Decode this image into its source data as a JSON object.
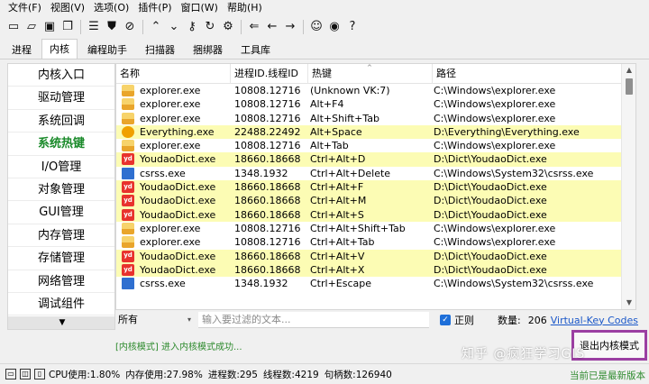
{
  "menubar": {
    "items": [
      "文件(F)",
      "视图(V)",
      "选项(O)",
      "插件(P)",
      "窗口(W)",
      "帮助(H)"
    ]
  },
  "toolbar": {
    "icons": [
      "monitor-icon",
      "open-folder-icon",
      "save-icon",
      "copy-icon",
      "windows-list-icon",
      "shield-icon",
      "ban-icon",
      "chevron-up-icon",
      "chevron-down-icon",
      "key-icon",
      "wrench-icon",
      "refresh-icon",
      "settings-icon",
      "back-icon",
      "forward-icon",
      "arrow-left-icon",
      "arrow-right-icon",
      "user-icon",
      "github-icon",
      "help-icon"
    ]
  },
  "tabs": [
    "进程",
    "内核",
    "编程助手",
    "扫描器",
    "捆绑器",
    "工具库"
  ],
  "active_tab": "内核",
  "leftnav": {
    "items": [
      "内核入口",
      "驱动管理",
      "系统回调",
      "系统热键",
      "I/O管理",
      "对象管理",
      "GUI管理",
      "内存管理",
      "存储管理",
      "网络管理",
      "调试组件"
    ],
    "active": "系统热键",
    "scroll_down": "▼"
  },
  "table": {
    "headers": [
      "名称",
      "进程ID.线程ID",
      "热键",
      "路径"
    ],
    "sort_indicator": "^",
    "rows": [
      {
        "icon": "folder",
        "name": "explorer.exe",
        "pid": "10808.12716",
        "hotkey": "(Unknown VK:7)",
        "path": "C:\\Windows\\explorer.exe",
        "hl": false
      },
      {
        "icon": "folder",
        "name": "explorer.exe",
        "pid": "10808.12716",
        "hotkey": "Alt+F4",
        "path": "C:\\Windows\\explorer.exe",
        "hl": false
      },
      {
        "icon": "folder",
        "name": "explorer.exe",
        "pid": "10808.12716",
        "hotkey": "Alt+Shift+Tab",
        "path": "C:\\Windows\\explorer.exe",
        "hl": false
      },
      {
        "icon": "search",
        "name": "Everything.exe",
        "pid": "22488.22492",
        "hotkey": "Alt+Space",
        "path": "D:\\Everything\\Everything.exe",
        "hl": true
      },
      {
        "icon": "folder",
        "name": "explorer.exe",
        "pid": "10808.12716",
        "hotkey": "Alt+Tab",
        "path": "C:\\Windows\\explorer.exe",
        "hl": false
      },
      {
        "icon": "yd",
        "name": "YoudaoDict.exe",
        "pid": "18660.18668",
        "hotkey": "Ctrl+Alt+D",
        "path": "D:\\Dict\\YoudaoDict.exe",
        "hl": true
      },
      {
        "icon": "sys",
        "name": "csrss.exe",
        "pid": "1348.1932",
        "hotkey": "Ctrl+Alt+Delete",
        "path": "C:\\Windows\\System32\\csrss.exe",
        "hl": false
      },
      {
        "icon": "yd",
        "name": "YoudaoDict.exe",
        "pid": "18660.18668",
        "hotkey": "Ctrl+Alt+F",
        "path": "D:\\Dict\\YoudaoDict.exe",
        "hl": true
      },
      {
        "icon": "yd",
        "name": "YoudaoDict.exe",
        "pid": "18660.18668",
        "hotkey": "Ctrl+Alt+M",
        "path": "D:\\Dict\\YoudaoDict.exe",
        "hl": true
      },
      {
        "icon": "yd",
        "name": "YoudaoDict.exe",
        "pid": "18660.18668",
        "hotkey": "Ctrl+Alt+S",
        "path": "D:\\Dict\\YoudaoDict.exe",
        "hl": true
      },
      {
        "icon": "folder",
        "name": "explorer.exe",
        "pid": "10808.12716",
        "hotkey": "Ctrl+Alt+Shift+Tab",
        "path": "C:\\Windows\\explorer.exe",
        "hl": false
      },
      {
        "icon": "folder",
        "name": "explorer.exe",
        "pid": "10808.12716",
        "hotkey": "Ctrl+Alt+Tab",
        "path": "C:\\Windows\\explorer.exe",
        "hl": false
      },
      {
        "icon": "yd",
        "name": "YoudaoDict.exe",
        "pid": "18660.18668",
        "hotkey": "Ctrl+Alt+V",
        "path": "D:\\Dict\\YoudaoDict.exe",
        "hl": true
      },
      {
        "icon": "yd",
        "name": "YoudaoDict.exe",
        "pid": "18660.18668",
        "hotkey": "Ctrl+Alt+X",
        "path": "D:\\Dict\\YoudaoDict.exe",
        "hl": true
      },
      {
        "icon": "sys",
        "name": "csrss.exe",
        "pid": "1348.1932",
        "hotkey": "Ctrl+Escape",
        "path": "C:\\Windows\\System32\\csrss.exe",
        "hl": false
      }
    ],
    "highlight_color": "#fcfcb4"
  },
  "filter": {
    "scope_value": "所有",
    "placeholder": "输入要过滤的文本...",
    "value": "",
    "regex_checked": true,
    "regex_label": "正则",
    "count_label": "数量:",
    "count_value": "206",
    "vk_link": "Virtual-Key Codes"
  },
  "log": {
    "text": "[内核模式] 进入内核模式成功..."
  },
  "exit_button": {
    "label": "退出内核模式",
    "highlight_color": "#9b3fa2"
  },
  "statusbar": {
    "cpu": "CPU使用:1.80%",
    "mem": "内存使用:27.98%",
    "procs": "进程数:295",
    "threads": "线程数:4219",
    "handles": "句柄数:126940",
    "update": "当前已是最新版本"
  },
  "watermark": "知乎 @疯狂学习GIS",
  "colors": {
    "accent_green": "#1a8a2a",
    "link_blue": "#1a57c9"
  }
}
